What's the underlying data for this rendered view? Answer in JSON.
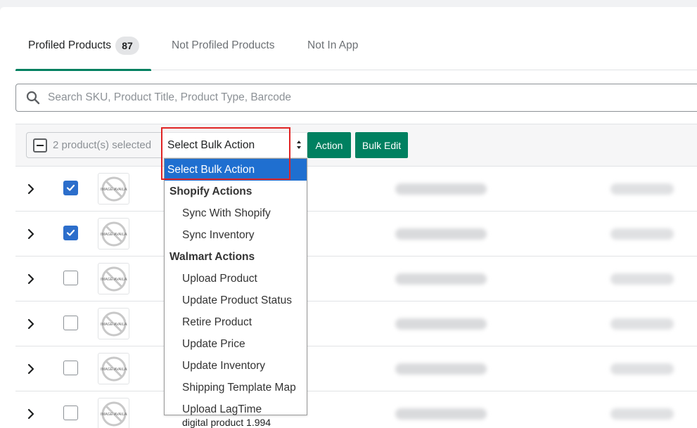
{
  "tabs": [
    {
      "label": "Profiled Products",
      "count": "87",
      "active": true
    },
    {
      "label": "Not Profiled Products"
    },
    {
      "label": "Not In App"
    }
  ],
  "search": {
    "placeholder": "Search SKU, Product Title, Product Type, Barcode"
  },
  "bulk_bar": {
    "selected_text": "2 product(s) selected",
    "select_value": "Select Bulk Action",
    "action_label": "Action",
    "bulk_edit_label": "Bulk Edit"
  },
  "dropdown": {
    "selected": "Select Bulk Action",
    "groups": [
      {
        "label": "Shopify Actions",
        "options": [
          "Sync With Shopify",
          "Sync Inventory"
        ]
      },
      {
        "label": "Walmart Actions",
        "options": [
          "Upload Product",
          "Update Product Status",
          "Retire Product",
          "Update Price",
          "Update Inventory",
          "Shipping Template Map",
          "Upload LagTime"
        ]
      }
    ]
  },
  "rows": [
    {
      "checked": true,
      "image_text": "NO IMAGE AVAILABLE"
    },
    {
      "checked": true,
      "image_text": "NO IMAGE AVAILABLE"
    },
    {
      "checked": false,
      "image_text": "NO IMAGE AVAILABLE"
    },
    {
      "checked": false,
      "image_text": "NO IMAGE AVAILABLE"
    },
    {
      "checked": false,
      "image_text": "NO IMAGE AVAILABLE"
    },
    {
      "checked": false,
      "image_text": "NO IMAGE AVAILABLE",
      "title": "digital product 1.994"
    }
  ],
  "colors": {
    "accent": "#008060",
    "selected_option": "#1f6fd0",
    "highlight": "#e02424",
    "checkbox": "#2c6ecb"
  }
}
